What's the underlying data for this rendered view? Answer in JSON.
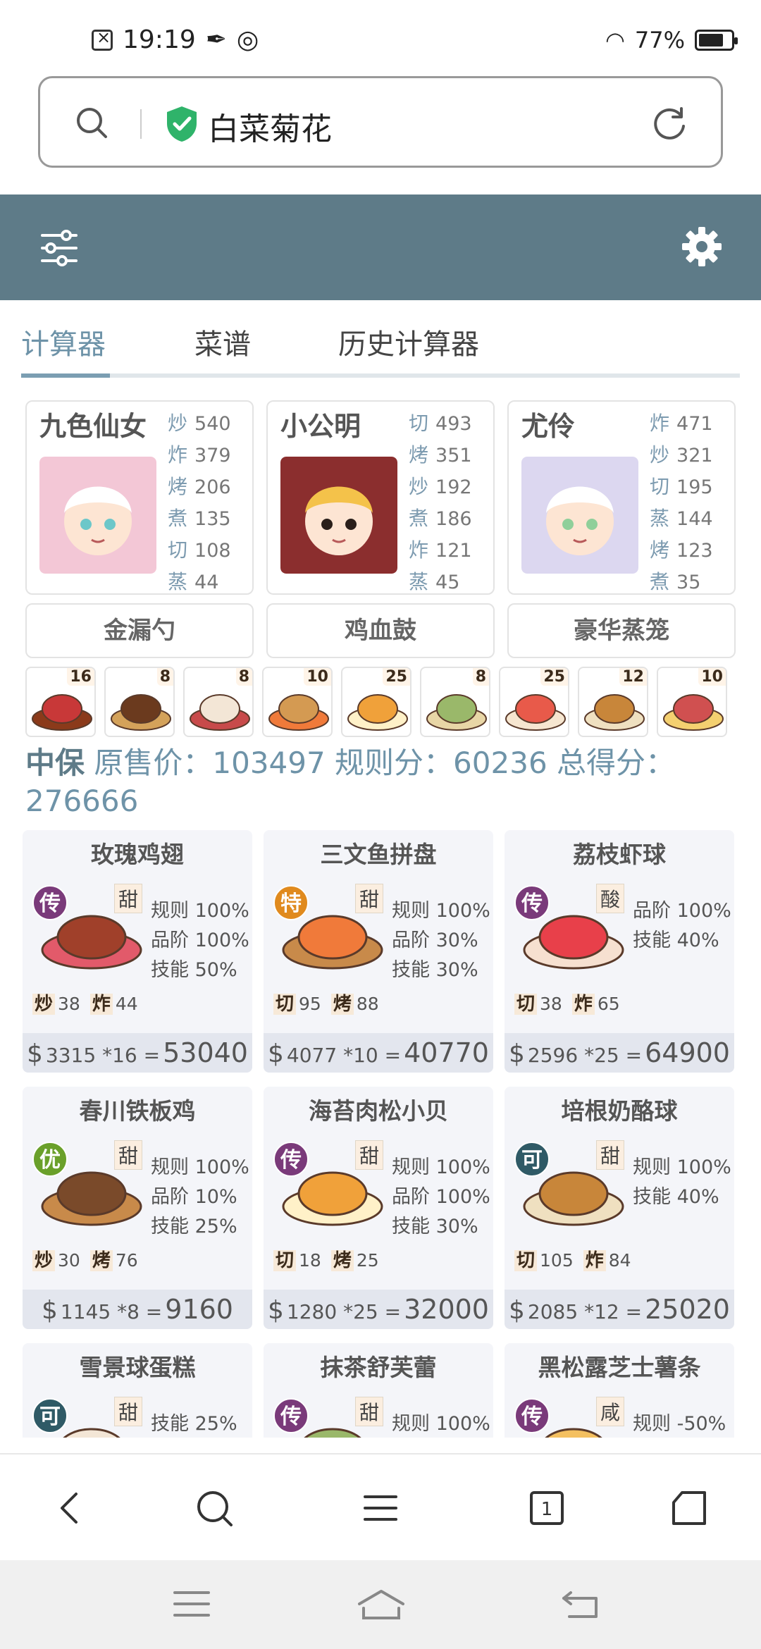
{
  "status_bar": {
    "time": "19:19",
    "battery": "77%",
    "battery_level": 0.77
  },
  "search": {
    "query": "白菜菊花"
  },
  "tabs": [
    {
      "label": "计算器"
    },
    {
      "label": "菜谱"
    },
    {
      "label": "历史计算器"
    }
  ],
  "chefs": [
    {
      "name": "九色仙女",
      "skills": [
        {
          "k": "炒",
          "v": "540"
        },
        {
          "k": "炸",
          "v": "379"
        },
        {
          "k": "烤",
          "v": "206"
        },
        {
          "k": "煮",
          "v": "135"
        },
        {
          "k": "切",
          "v": "108"
        },
        {
          "k": "蒸",
          "v": "44"
        }
      ]
    },
    {
      "name": "小公明",
      "skills": [
        {
          "k": "切",
          "v": "493"
        },
        {
          "k": "烤",
          "v": "351"
        },
        {
          "k": "炒",
          "v": "192"
        },
        {
          "k": "煮",
          "v": "186"
        },
        {
          "k": "炸",
          "v": "121"
        },
        {
          "k": "蒸",
          "v": "45"
        }
      ]
    },
    {
      "name": "尤伶",
      "skills": [
        {
          "k": "炸",
          "v": "471"
        },
        {
          "k": "炒",
          "v": "321"
        },
        {
          "k": "切",
          "v": "195"
        },
        {
          "k": "蒸",
          "v": "144"
        },
        {
          "k": "烤",
          "v": "123"
        },
        {
          "k": "煮",
          "v": "35"
        }
      ]
    }
  ],
  "tools": [
    "金漏勺",
    "鸡血鼓",
    "豪华蒸笼"
  ],
  "dish_counts": [
    "16",
    "8",
    "8",
    "10",
    "25",
    "8",
    "25",
    "12",
    "10"
  ],
  "summary": {
    "chef": "中保",
    "text": "原售价：103497 规则分：60236 总得分：276666"
  },
  "dishes": [
    {
      "name": "玫瑰鸡翅",
      "rank": "传",
      "rank_color": "#7a3a7a",
      "flavor": "甜",
      "stats": [
        "规则 100%",
        "品阶 100%",
        "技能 50%"
      ],
      "req": [
        {
          "k": "炒",
          "v": "38"
        },
        {
          "k": "炸",
          "v": "44"
        }
      ],
      "price": "3315",
      "qty": "*16",
      "total": "53040"
    },
    {
      "name": "三文鱼拼盘",
      "rank": "特",
      "rank_color": "#e08a1e",
      "flavor": "甜",
      "stats": [
        "规则 100%",
        "品阶 30%",
        "技能 30%"
      ],
      "req": [
        {
          "k": "切",
          "v": "95"
        },
        {
          "k": "烤",
          "v": "88"
        }
      ],
      "price": "4077",
      "qty": "*10",
      "total": "40770"
    },
    {
      "name": "荔枝虾球",
      "rank": "传",
      "rank_color": "#7a3a7a",
      "flavor": "酸",
      "stats": [
        "品阶 100%",
        "技能 40%"
      ],
      "req": [
        {
          "k": "切",
          "v": "38"
        },
        {
          "k": "炸",
          "v": "65"
        }
      ],
      "price": "2596",
      "qty": "*25",
      "total": "64900"
    },
    {
      "name": "春川铁板鸡",
      "rank": "优",
      "rank_color": "#6aa02a",
      "flavor": "甜",
      "stats": [
        "规则 100%",
        "品阶 10%",
        "技能 25%"
      ],
      "req": [
        {
          "k": "炒",
          "v": "30"
        },
        {
          "k": "烤",
          "v": "76"
        }
      ],
      "price": "1145",
      "qty": "*8",
      "total": "9160"
    },
    {
      "name": "海苔肉松小贝",
      "rank": "传",
      "rank_color": "#7a3a7a",
      "flavor": "甜",
      "stats": [
        "规则 100%",
        "品阶 100%",
        "技能 30%"
      ],
      "req": [
        {
          "k": "切",
          "v": "18"
        },
        {
          "k": "烤",
          "v": "25"
        }
      ],
      "price": "1280",
      "qty": "*25",
      "total": "32000"
    },
    {
      "name": "培根奶酪球",
      "rank": "可",
      "rank_color": "#2f5a66",
      "flavor": "甜",
      "stats": [
        "规则 100%",
        "技能 40%"
      ],
      "req": [
        {
          "k": "切",
          "v": "105"
        },
        {
          "k": "炸",
          "v": "84"
        }
      ],
      "price": "2085",
      "qty": "*12",
      "total": "25020"
    },
    {
      "name": "雪景球蛋糕",
      "rank": "可",
      "rank_color": "#2f5a66",
      "flavor": "甜",
      "stats": [
        "技能 25%"
      ],
      "req": [],
      "price": "",
      "qty": "",
      "total": ""
    },
    {
      "name": "抹茶舒芙蕾",
      "rank": "传",
      "rank_color": "#7a3a7a",
      "flavor": "甜",
      "stats": [
        "规则 100%"
      ],
      "req": [],
      "price": "",
      "qty": "",
      "total": ""
    },
    {
      "name": "黑松露芝士薯条",
      "rank": "传",
      "rank_color": "#7a3a7a",
      "flavor": "咸",
      "stats": [
        "规则 -50%"
      ],
      "req": [],
      "price": "",
      "qty": "",
      "total": ""
    }
  ],
  "colors": {
    "appbar": "#5e7b88",
    "accent": "#6e93a8"
  },
  "browser_tab_count": "1"
}
